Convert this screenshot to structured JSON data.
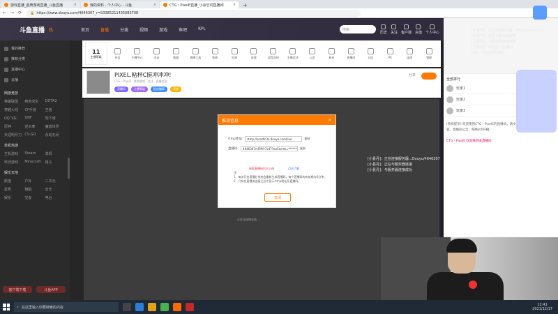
{
  "browser": {
    "tabs": [
      {
        "title": "游戏直播_金牌游戏直播_斗鱼直播",
        "active": false
      },
      {
        "title": "我的资料 - 个人中心 - 斗鱼",
        "active": false
      },
      {
        "title": "CTG丶PixelE直播_小会忘词直播间",
        "active": true
      }
    ],
    "new_tab": "+",
    "url": "https://www.douyu.com/4646307_r=S3385211435083708"
  },
  "site": {
    "logo": "斗鱼直播",
    "hot": "热",
    "nav": [
      "首页",
      "直播",
      "分类",
      "视频",
      "游戏",
      "鱼吧",
      "KPL"
    ],
    "nav_active": "直播",
    "search_placeholder": "搜索",
    "icons": [
      {
        "label": "历史",
        "icon": "history-icon"
      },
      {
        "label": "关注",
        "icon": "heart-icon"
      },
      {
        "label": "客户端",
        "icon": "download-icon"
      },
      {
        "label": "充值",
        "icon": "wallet-icon"
      },
      {
        "label": "个人中心",
        "icon": "user-icon"
      }
    ]
  },
  "sidebar": {
    "items": [
      "我的推荐",
      "推荐分类",
      "直播中心",
      "云播"
    ],
    "sections": [
      {
        "title": "网游竞技",
        "cells": [
          "英雄联盟",
          "绝地求生",
          "DOTA2",
          "穿越火线",
          "CF手游",
          "王者",
          "QQ飞车",
          "DNF",
          "地下城",
          "原神",
          "逆水寒",
          "魔兽世界",
          "天涯明月刀",
          "CS:GO",
          "永劫无间"
        ]
      },
      {
        "title": "单机热游",
        "cells": [
          "主机游戏",
          "Steam",
          "单机",
          "怀旧游戏",
          "Minecraft",
          "格斗"
        ]
      },
      {
        "title": "娱乐天地",
        "cells": [
          "颜值",
          "户外",
          "二次元",
          "星秀",
          "舞蹈",
          "音乐",
          "娱乐",
          "交友",
          "电台"
        ]
      }
    ],
    "buttons": [
      "客户端下载",
      "斗鱼APP"
    ]
  },
  "toolbar": {
    "level_num": "11",
    "level_label": "主播等级",
    "tools": [
      "任务",
      "主播中心",
      "活动",
      "数据",
      "直播工具",
      "鱼吧",
      "礼物",
      "成就",
      "语音连线",
      "主播对决",
      "公会",
      "粉丝",
      "直播间",
      "分区",
      "PK",
      "连线",
      "管理"
    ]
  },
  "streamer": {
    "name": "PIXEL.粘杯C挺冲冲冲!",
    "meta": "CTG丶PixelE  · 其他游戏 · 关注 · 直播信息",
    "badges": [
      "直播间",
      "主播等级",
      "粉丝徽章",
      "贵族"
    ],
    "share": "分享",
    "follow": "关注"
  },
  "stream": {
    "hint": "正在连接服务器…"
  },
  "dialog": {
    "title": "推流信息",
    "close_icon": "×",
    "rtmp_label": "rtmp地址:",
    "rtmp_value": "rtmp://sendtc3a.douyu.com/live",
    "copy1": "复制",
    "stream_label": "直播码:",
    "stream_value": "4646307rvFMYr7x47?wsSecret=********",
    "copy2": "复制",
    "warn": "获取直播码后已上线",
    "warn_link": "点击了解",
    "note_title": "注:",
    "note1": "1、每次开启直播后系统会重新生成直播码，每个直播码的有效期为6分钟。",
    "note2": "2、只有在直播流连接之后才显示rtmp地址及直播码。",
    "close_btn": "关闭"
  },
  "overlay": {
    "top": [
      "[小县丹]：正在连接服务器...Douyu/4646307",
      "[小县丹]：正在与服务器连接",
      "[小县丹]：与服务器连接成功",
      "[小县丹]：欢迎进入直播间",
      "CTG丶Pixel的直播间"
    ],
    "mid": [
      "[小县丹]：正在连接服务器...Douyu/4646307",
      "[小县丹]：正在与服务器连接",
      "[小县丹]：与服务器连接成功"
    ]
  },
  "rightpanel": {
    "title": "全部排行",
    "ranks": [
      "玩家1",
      "玩家2",
      "玩家3"
    ],
    "chat": "[系统提示] 欢迎来到CTG丶PixelE的直播间，请文明发言，禁止发布违规内容。直播间公告：每晚8点开播。",
    "chat2": "CTG丶PixelE 欢迎来到本直播间"
  },
  "taskbar": {
    "search": "在这里输入你要搜索的内容",
    "time": "12:41",
    "date": "2021/12/17"
  }
}
